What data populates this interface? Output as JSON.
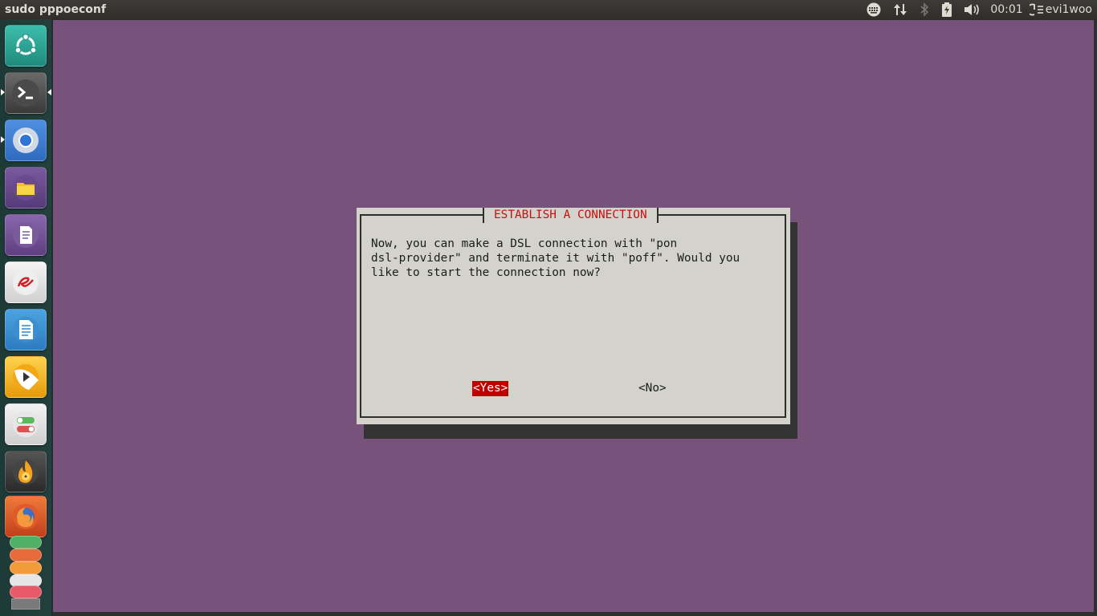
{
  "top_panel": {
    "window_title": "sudo pppoeconf",
    "clock": "00:01",
    "user": "evi1woo",
    "indicators": [
      "keyboard-icon",
      "network-updown-icon",
      "bluetooth-icon",
      "battery-icon",
      "volume-icon",
      "power-session-icon"
    ]
  },
  "launcher": {
    "items": [
      {
        "name": "ubuntu-dash-icon",
        "color": "#2fa89a"
      },
      {
        "name": "terminal-icon",
        "color": "#4a4a4a",
        "running": true,
        "focused": true
      },
      {
        "name": "chromium-icon",
        "color": "#3b7fd4",
        "running": true
      },
      {
        "name": "files-icon",
        "color": "#6a4a8c"
      },
      {
        "name": "text-editor-icon",
        "color": "#7b5a9c"
      },
      {
        "name": "text-app-icon",
        "color": "#e8e8e8"
      },
      {
        "name": "libreoffice-writer-icon",
        "color": "#3b8fcf"
      },
      {
        "name": "media-player-icon",
        "color": "#f2a817"
      },
      {
        "name": "system-settings-icon",
        "color": "#e0e0e0"
      },
      {
        "name": "burner-icon",
        "color": "#3a3a3a"
      },
      {
        "name": "firefox-icon",
        "color": "#e05a2a"
      },
      {
        "name": "stacked-apps-icon",
        "color": "#5aa865"
      }
    ]
  },
  "dialog": {
    "title": "ESTABLISH A CONNECTION",
    "message": "Now, you can make a DSL connection with \"pon\ndsl-provider\" and terminate it with \"poff\". Would you\nlike to start the connection now?",
    "yes_label": "<Yes>",
    "no_label": "<No>"
  },
  "colors": {
    "terminal_background": "#77527a",
    "dialog_background": "#d3d3cc",
    "dialog_title": "#c81010",
    "selected_button": "#c00000"
  }
}
